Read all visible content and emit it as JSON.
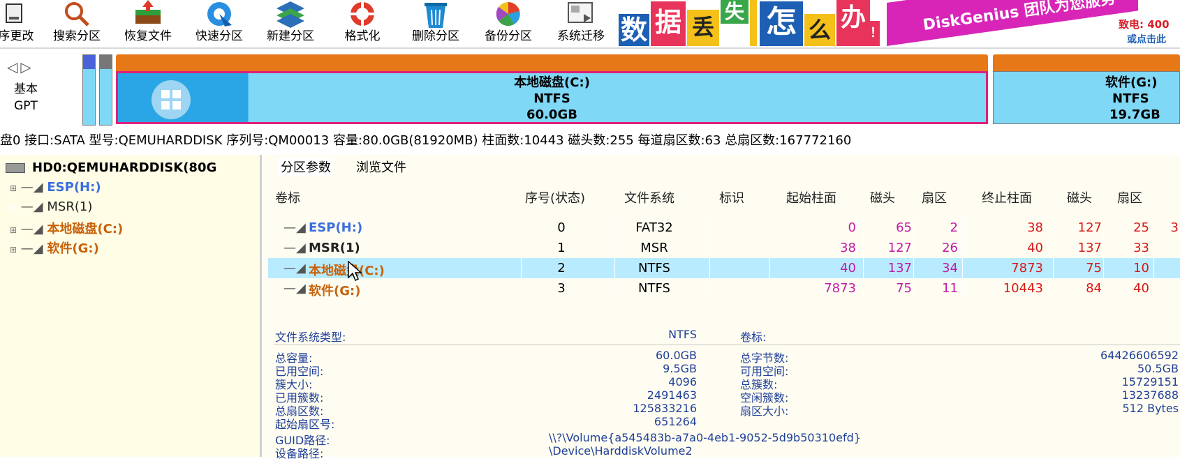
{
  "toolbar": {
    "items": [
      {
        "label": "序更改",
        "icon": "disk-change-icon"
      },
      {
        "label": "搜索分区",
        "icon": "search-magnifier-icon"
      },
      {
        "label": "恢复文件",
        "icon": "recover-file-icon"
      },
      {
        "label": "快速分区",
        "icon": "quick-partition-icon"
      },
      {
        "label": "新建分区",
        "icon": "new-partition-icon"
      },
      {
        "label": "格式化",
        "icon": "format-icon"
      },
      {
        "label": "删除分区",
        "icon": "delete-partition-icon"
      },
      {
        "label": "备份分区",
        "icon": "backup-partition-icon"
      },
      {
        "label": "系统迁移",
        "icon": "system-migrate-icon"
      }
    ]
  },
  "banner": {
    "chars": [
      "数",
      "据",
      "丢",
      "失",
      "怎",
      "么",
      "办",
      "！"
    ],
    "slogan": "DiskGenius 团队为您服务",
    "phone": "致电: 400",
    "click": "或点击此"
  },
  "diskbar": {
    "disk_type": "基本",
    "disk_style": "GPT",
    "partition_c": {
      "name": "本地磁盘(C:)",
      "fs": "NTFS",
      "size": "60.0GB"
    },
    "partition_g": {
      "name": "软件(G:)",
      "fs": "NTFS",
      "size": "19.7GB"
    }
  },
  "diskinfo": "盘0 接口:SATA  型号:QEMUHARDDISK  序列号:QM00013  容量:80.0GB(81920MB)  柱面数:10443  磁头数:255  每道扇区数:63  总扇区数:167772160",
  "tree": {
    "root": "HD0:QEMUHARDDISK(80G",
    "items": [
      {
        "label": "ESP(H:)",
        "color": "#3a6de0"
      },
      {
        "label": "MSR(1)",
        "color": "#222222"
      },
      {
        "label": "本地磁盘(C:)",
        "color": "#c7620b"
      },
      {
        "label": "软件(G:)",
        "color": "#c7620b"
      }
    ]
  },
  "tabs": [
    "分区参数",
    "浏览文件"
  ],
  "grid": {
    "headers": [
      "卷标",
      "序号(状态)",
      "文件系统",
      "标识",
      "起始柱面",
      "磁头",
      "扇区",
      "终止柱面",
      "磁头",
      "扇区"
    ],
    "rows": [
      {
        "name": "ESP(H:)",
        "idx": "0",
        "fs": "FAT32",
        "scyl": "0",
        "shead": "65",
        "ssec": "2",
        "ecyl": "38",
        "ehead": "127",
        "esec": "25",
        "extra": "3",
        "color": "#3a6de0"
      },
      {
        "name": "MSR(1)",
        "idx": "1",
        "fs": "MSR",
        "scyl": "38",
        "shead": "127",
        "ssec": "26",
        "ecyl": "40",
        "ehead": "137",
        "esec": "33",
        "extra": "",
        "color": "#222222"
      },
      {
        "name": "本地磁盘(C:)",
        "idx": "2",
        "fs": "NTFS",
        "scyl": "40",
        "shead": "137",
        "ssec": "34",
        "ecyl": "7873",
        "ehead": "75",
        "esec": "10",
        "extra": "",
        "color": "#c7620b"
      },
      {
        "name": "软件(G:)",
        "idx": "3",
        "fs": "NTFS",
        "scyl": "7873",
        "shead": "75",
        "ssec": "11",
        "ecyl": "10443",
        "ehead": "84",
        "esec": "40",
        "extra": "",
        "color": "#c7620b"
      }
    ]
  },
  "details": {
    "fs_type_label": "文件系统类型:",
    "fs_type": "NTFS",
    "volume_label": "卷标:",
    "left": [
      {
        "k": "总容量:",
        "v": "60.0GB"
      },
      {
        "k": "已用空间:",
        "v": "9.5GB"
      },
      {
        "k": "簇大小:",
        "v": "4096"
      },
      {
        "k": "已用簇数:",
        "v": "2491463"
      },
      {
        "k": "总扇区数:",
        "v": "125833216"
      },
      {
        "k": "起始扇区号:",
        "v": "651264"
      }
    ],
    "right": [
      {
        "k": "总字节数:",
        "v": "64426606592"
      },
      {
        "k": "可用空间:",
        "v": "50.5GB"
      },
      {
        "k": "总簇数:",
        "v": "15729151"
      },
      {
        "k": "空闲簇数:",
        "v": "13237688"
      },
      {
        "k": "扇区大小:",
        "v": "512 Bytes"
      }
    ],
    "guid_label": "GUID路径:",
    "guid": "\\\\?\\Volume{a545483b-a7a0-4eb1-9052-5d9b50310efd}",
    "dev_label": "设备路径:",
    "dev": "\\Device\\HarddiskVolume2"
  }
}
